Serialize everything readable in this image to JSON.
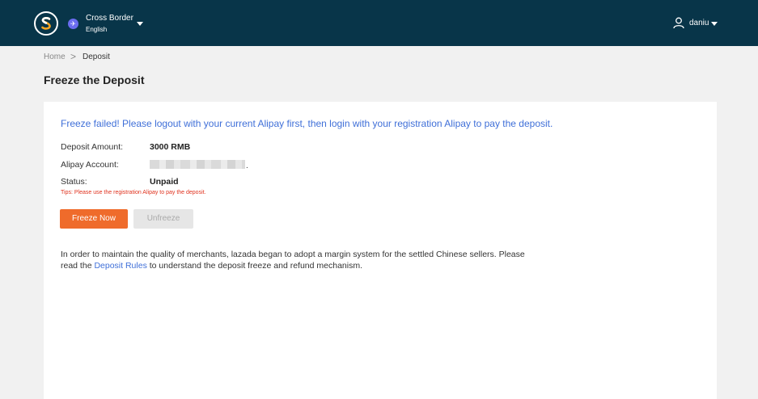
{
  "header": {
    "logo_icon": "s-logo-icon",
    "site_badge_icon": "plane-icon",
    "site_name": "Cross Border",
    "site_language": "English",
    "user_icon": "user-icon",
    "username": "daniu"
  },
  "breadcrumb": {
    "home": "Home",
    "separator": ">",
    "current": "Deposit"
  },
  "page_title": "Freeze the Deposit",
  "alert": "Freeze failed! Please logout with your current Alipay first, then login with your registration Alipay to pay the deposit.",
  "fields": {
    "deposit_amount_label": "Deposit Amount:",
    "deposit_amount_value": "3000 RMB",
    "alipay_account_label": "Alipay Account:",
    "alipay_account_suffix": ".",
    "status_label": "Status:",
    "status_value": "Unpaid"
  },
  "tips": "Tips: Please use the registration Alipay to pay the deposit.",
  "buttons": {
    "freeze": "Freeze Now",
    "unfreeze": "Unfreeze"
  },
  "info": {
    "line1": "In order to maintain the quality of merchants, lazada began to adopt a margin system for the settled Chinese sellers. Please",
    "line2_prefix": "read the ",
    "link": "Deposit Rules",
    "line2_suffix": " to understand the deposit freeze and refund mechanism."
  },
  "colors": {
    "header_bg": "#083549",
    "accent_orange": "#ef6b2b",
    "link_blue": "#3f6fd8",
    "error_red": "#e0321e"
  }
}
